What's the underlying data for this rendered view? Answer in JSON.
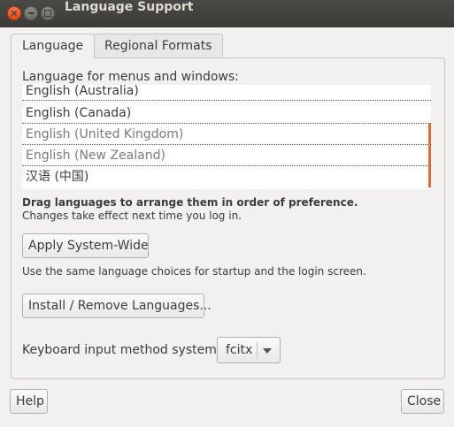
{
  "window": {
    "title": "Language Support"
  },
  "tabs": [
    {
      "label": "Language"
    },
    {
      "label": "Regional Formats"
    }
  ],
  "language_section": {
    "heading": "Language for menus and windows:",
    "items": [
      {
        "label": "English (Australia)"
      },
      {
        "label": "English (Canada)"
      },
      {
        "label": "English (United Kingdom)"
      },
      {
        "label": "English (New Zealand)"
      },
      {
        "label": "汉语 (中国)"
      }
    ],
    "hint_bold": "Drag languages to arrange them in order of preference.",
    "hint": "Changes take effect next time you log in."
  },
  "apply_button": "Apply System-Wide",
  "apply_desc": "Use the same language choices for startup and the login screen.",
  "install_button": "Install / Remove Languages...",
  "keyboard": {
    "label": "Keyboard input method system:",
    "value": "fcitx"
  },
  "footer": {
    "help": "Help",
    "close": "Close"
  },
  "colors": {
    "accent": "#e16d3a",
    "titlebar": "#3c3b37"
  }
}
